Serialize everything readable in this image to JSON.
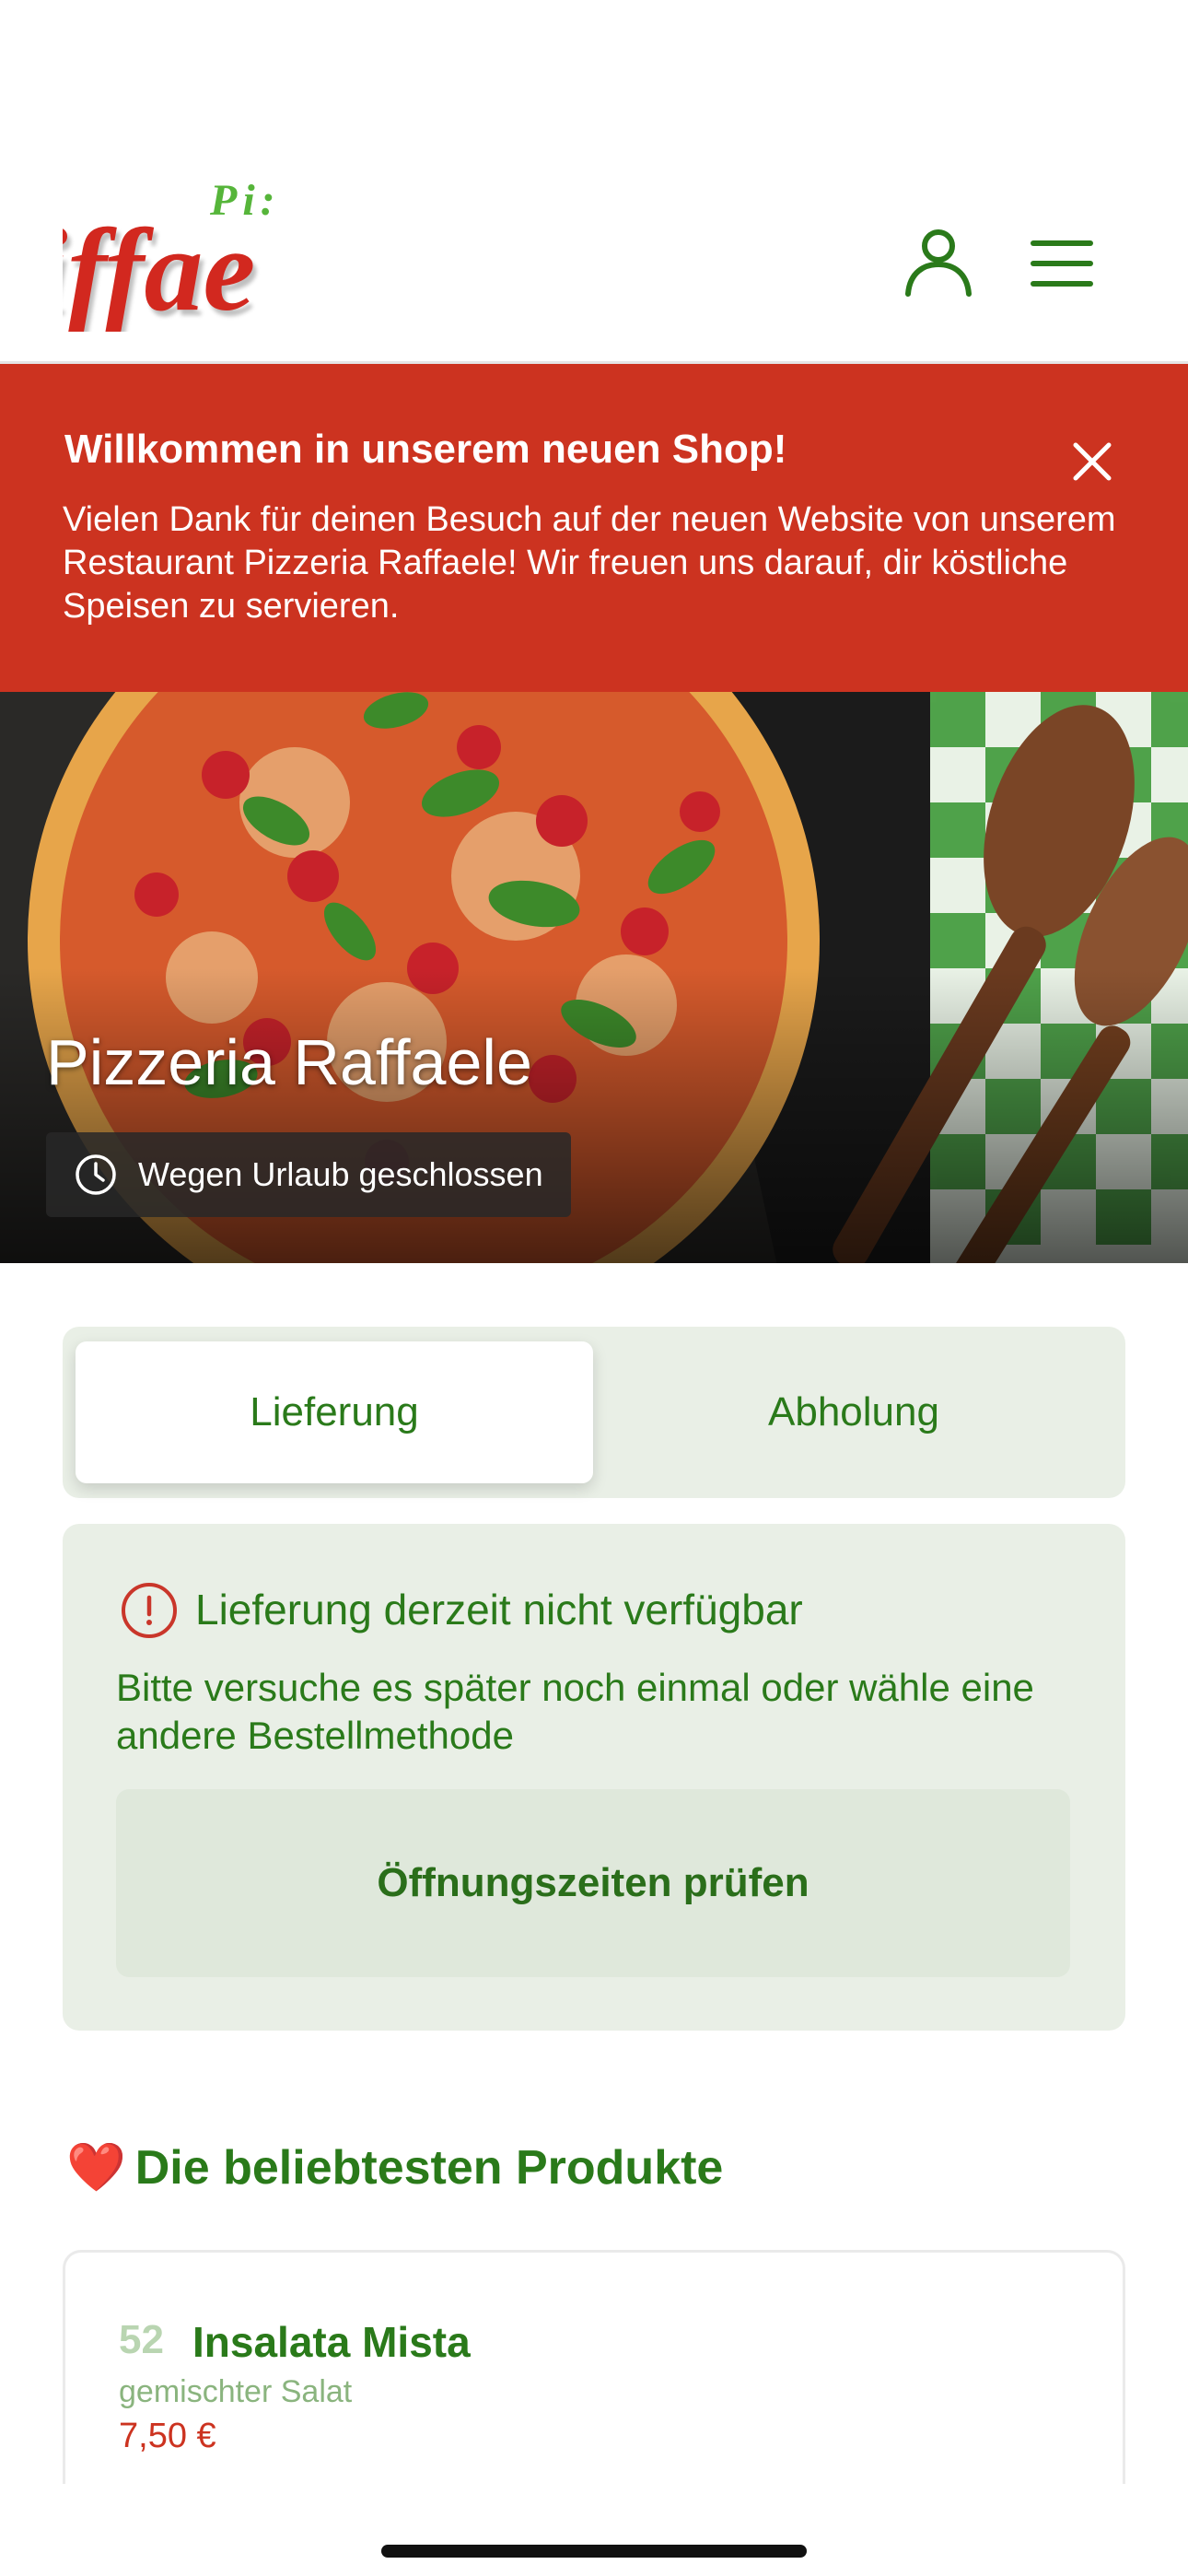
{
  "header": {
    "logo_top": "Pi:",
    "logo_main": "iffae",
    "icons": {
      "account": "user-icon",
      "menu": "hamburger-menu-icon"
    }
  },
  "banner": {
    "title": "Willkommen in unserem neuen Shop!",
    "text": "Vielen Dank für deinen Besuch auf der neuen Website von unserem Restaurant Pizzeria Raffaele! Wir freuen uns darauf, dir köstliche Speisen zu servieren.",
    "close_icon": "close-icon"
  },
  "hero": {
    "title": "Pizzeria Raffaele",
    "status": "Wegen Urlaub geschlossen",
    "status_icon": "clock-icon"
  },
  "tabs": [
    {
      "label": "Lieferung",
      "active": true
    },
    {
      "label": "Abholung",
      "active": false
    }
  ],
  "notice": {
    "title": "Lieferung derzeit nicht verfügbar",
    "text": "Bitte versuche es später noch einmal oder wähle eine andere Bestellmethode",
    "button": "Öffnungszeiten prüfen",
    "icon": "info-icon"
  },
  "popular": {
    "heart": "❤️",
    "title": "Die beliebtesten Produkte",
    "items": [
      {
        "number": "52",
        "name": "Insalata Mista",
        "description": "gemischter Salat",
        "price": "7,50 €"
      }
    ]
  },
  "colors": {
    "brand_green": "#2a7a1a",
    "banner_red": "#cc3320",
    "panel_bg": "#e9efe6"
  }
}
